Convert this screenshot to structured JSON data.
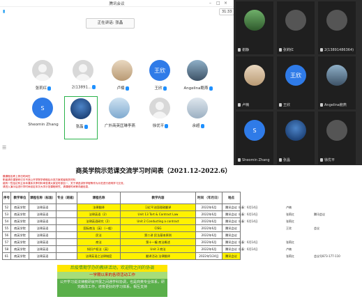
{
  "meeting_light": {
    "title": "腾讯会议",
    "clock": "31:33",
    "speaking": "正在讲话: 张晶",
    "participants": [
      {
        "name": "张莉红",
        "avatar": ""
      },
      {
        "name": "2(13891...",
        "avatar": ""
      },
      {
        "name": "卢楠",
        "avatar": ""
      },
      {
        "name": "王欣",
        "avatar": "王欣"
      },
      {
        "name": "Angelina鲍燕",
        "avatar": ""
      },
      {
        "name": "Sheomin Zhang",
        "avatar": "S"
      },
      {
        "name": "张晶",
        "avatar": ""
      },
      {
        "name": "广外商英匡琳李燕",
        "avatar": ""
      },
      {
        "name": "徐优平",
        "avatar": ""
      },
      {
        "name": "余超",
        "avatar": ""
      }
    ]
  },
  "meeting_dark": {
    "tiles": [
      {
        "name": "谢静",
        "avatar": ""
      },
      {
        "name": "张莉红",
        "avatar": ""
      },
      {
        "name": "2(13891486364)",
        "avatar": ""
      },
      {
        "name": "卢楠",
        "avatar": ""
      },
      {
        "name": "王欣",
        "avatar": "王欣"
      },
      {
        "name": "Angelina鲍燕",
        "avatar": ""
      },
      {
        "name": "Sheomin Zhang",
        "avatar": "S"
      },
      {
        "name": "张晶",
        "avatar": ""
      },
      {
        "name": "徐优平",
        "avatar": ""
      }
    ]
  },
  "sheet": {
    "title": "商英学院示范课交流学习时间表（2021.12-2022.6）",
    "notes": [
      "模课程名称上停泊时间在",
      "职者请在课堂研讨中不违公开学院学修程后示范方案或者相关材料",
      "能有一些结论有主持本课序共享材料审查请大家定时参加一、关于请选讲所学程等作为示范进行说明学习交流，",
      "请进入演示后进行学时间设定本次大学示范课程研究，请课程时间等详细信息，"
    ],
    "headers": [
      "序号",
      "教学单位",
      "课程名称（标准）",
      "专业（班级）",
      "课程名称",
      "教学内容",
      "时间\n（年月日）",
      "地点"
    ],
    "rows": [
      [
        "52",
        "商英学院",
        "法律英语",
        "",
        "法律翻译",
        "习近平治国理政翻译",
        "2022年6月",
        "腾讯会议"
      ],
      [
        "53",
        "商英学院",
        "法律英语",
        "",
        "法律英语（2）",
        "Unit 13 Tort & Contract Law",
        "2022年6月",
        "腾讯会议"
      ],
      [
        "54",
        "商英学院",
        "法律英语",
        "",
        "法律英语研究（2）",
        "Unit 2 Conducting a contract",
        "2022年6月",
        "腾讯会议"
      ],
      [
        "55",
        "商英学院",
        "法律英语",
        "",
        "国际商法（英）（一般）",
        "CISG",
        "2022年6月",
        "腾讯会议"
      ],
      [
        "56",
        "商英学院",
        "法律英语",
        "",
        "民法",
        "第二讲 民法基本原则",
        "2022年6月",
        "腾讯会议"
      ],
      [
        "57",
        "商英学院",
        "法律英语",
        "",
        "商法",
        "第十一编 商法概述",
        "2022年6月",
        "腾讯会议"
      ],
      [
        "58",
        "商英学院",
        "法律英语",
        "",
        "知识产权法（英）",
        "Unit 3 商法",
        "2022年6月",
        "腾讯会议"
      ],
      [
        "61",
        "商英学院",
        "法律英语",
        "",
        "法律英语之法律制度",
        "翻译活动 法律翻译",
        "2022年5/24日",
        "腾讯会议"
      ]
    ],
    "side": [
      [
        "杜春：6月14日",
        "卢楠",
        ""
      ],
      [
        "杜春：6月14日",
        "张莉红",
        "腾讯会议"
      ],
      [
        "杜春：6月14日",
        "张莉红",
        ""
      ],
      [
        "",
        "王欣",
        "会议"
      ],
      [
        "",
        "",
        ""
      ],
      [
        "杜春：6月14日",
        "张莉红",
        ""
      ],
      [
        "杜春：6月14日",
        "卢楠",
        ""
      ],
      [
        "",
        "张莉红",
        "会议号873-177-110"
      ]
    ],
    "banner1": "后疫情期学办的教研活动，欢迎院之间的协调",
    "banner2": "一学期以来的各项活动工作",
    "banner3": "公开学习说法律教研就开展之间通学科协调，也是商英专业体系，研究教改工作，培育更好的学习体系，相互支持"
  }
}
